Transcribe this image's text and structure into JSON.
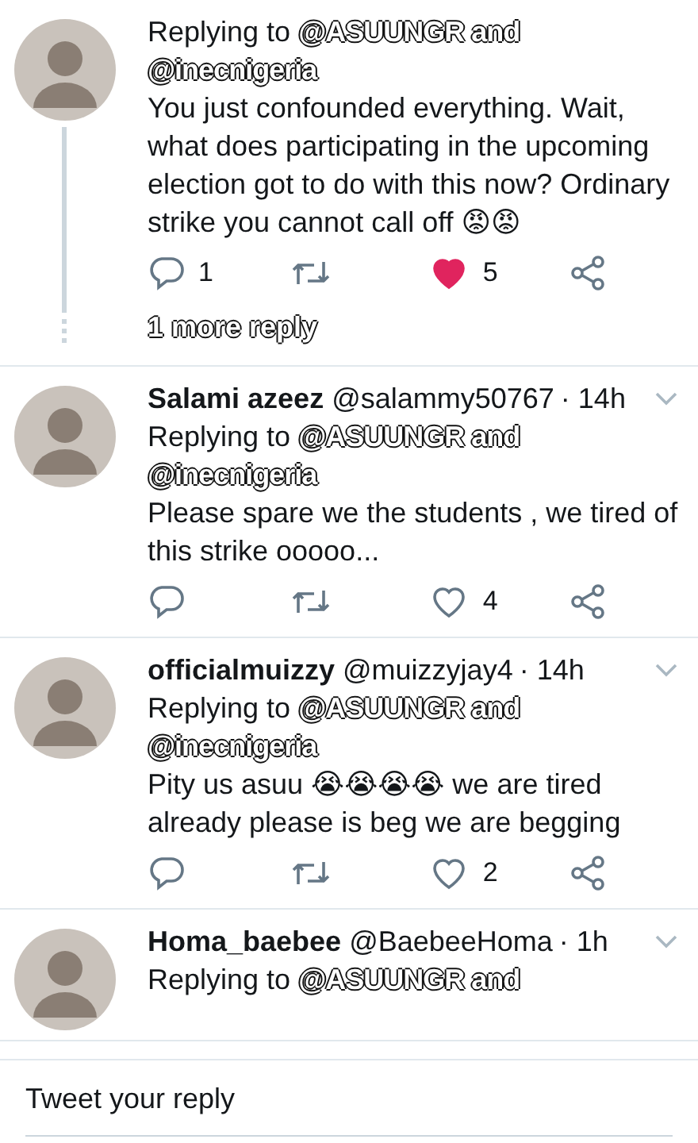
{
  "tweets": [
    {
      "thread": true,
      "replying_label": "Replying to",
      "mentions": [
        "@ASUUNGR and",
        "@inecnigeria"
      ],
      "text": "You just confounded everything. Wait, what does participating in the upcoming election got to do with this now? Ordinary strike you cannot call off 😡😡",
      "reply_count": "1",
      "like_count": "5",
      "liked": true,
      "more_replies": "1 more reply"
    },
    {
      "name": "Salami azeez",
      "handle": "@salammy50767",
      "time": "· 14h",
      "replying_label": "Replying to",
      "mentions": [
        "@ASUUNGR and",
        "@inecnigeria"
      ],
      "text": "Please spare we the students , we tired of this strike ooooo...",
      "like_count": "4",
      "liked": false
    },
    {
      "name": "officialmuizzy",
      "handle": "@muizzyjay4",
      "time": "· 14h",
      "replying_label": "Replying to",
      "mentions": [
        "@ASUUNGR and",
        "@inecnigeria"
      ],
      "text": "Pity us asuu 😭😭😭😭 we are tired already please is beg we are begging",
      "like_count": "2",
      "liked": false
    },
    {
      "name": "Homa_baebee",
      "handle": "@BaebeeHoma",
      "time": "· 1h",
      "replying_label": "Replying to",
      "mentions": [
        "@ASUUNGR and"
      ]
    }
  ],
  "composer": {
    "placeholder": "Tweet your reply"
  }
}
